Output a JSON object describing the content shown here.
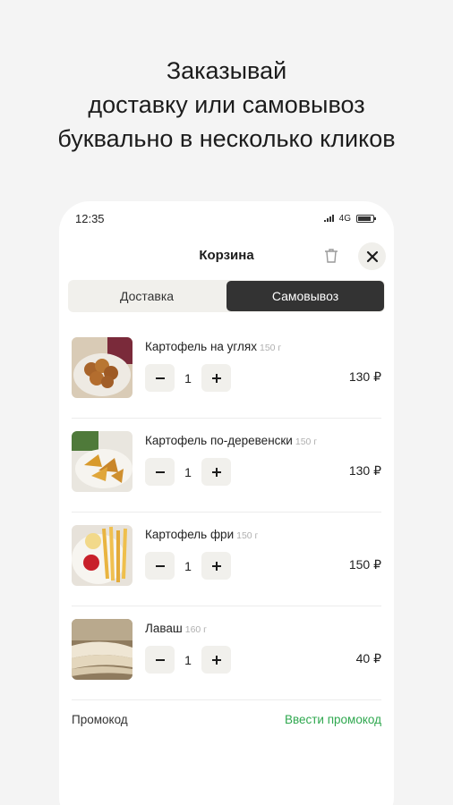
{
  "headline": {
    "line1": "Заказывай",
    "line2": "доставку или самовывоз",
    "line3": "буквально в несколько кликов"
  },
  "status_bar": {
    "time": "12:35",
    "network": "4G"
  },
  "header": {
    "title": "Корзина"
  },
  "tabs": [
    {
      "label": "Доставка",
      "active": false
    },
    {
      "label": "Самовывоз",
      "active": true
    }
  ],
  "items": [
    {
      "name": "Картофель на углях",
      "weight": "150 г",
      "qty": "1",
      "price": "130 ₽"
    },
    {
      "name": "Картофель по-деревенски",
      "weight": "150 г",
      "qty": "1",
      "price": "130 ₽"
    },
    {
      "name": "Картофель фри",
      "weight": "150 г",
      "qty": "1",
      "price": "150 ₽"
    },
    {
      "name": "Лаваш",
      "weight": "160 г",
      "qty": "1",
      "price": "40 ₽"
    }
  ],
  "promo": {
    "label": "Промокод",
    "link": "Ввести промокод"
  },
  "colors": {
    "accent_green": "#2fa84f",
    "active_tab": "#333333",
    "chip_bg": "#f1f0ec"
  }
}
